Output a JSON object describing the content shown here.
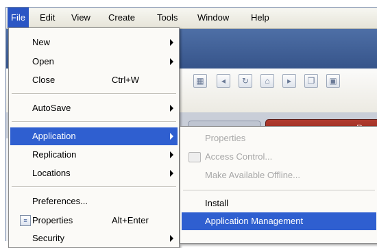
{
  "menubar": {
    "items": [
      "File",
      "Edit",
      "View",
      "Create",
      "Tools",
      "Window",
      "Help"
    ],
    "active_index": 0
  },
  "tab": {
    "partial_label": "Dea"
  },
  "toolbar_icons": [
    "form-icon",
    "back-icon",
    "refresh-icon",
    "home-icon",
    "forward-icon",
    "copy-icon",
    "save-icon"
  ],
  "file_menu": {
    "items": [
      {
        "label": "New",
        "submenu": true
      },
      {
        "label": "Open",
        "submenu": true
      },
      {
        "label": "Close",
        "shortcut": "Ctrl+W"
      },
      {
        "label": "AutoSave",
        "submenu": true
      },
      {
        "label": "Application",
        "submenu": true,
        "selected": true
      },
      {
        "label": "Replication",
        "submenu": true
      },
      {
        "label": "Locations",
        "submenu": true
      },
      {
        "label": "Preferences..."
      },
      {
        "label": "Properties",
        "shortcut": "Alt+Enter",
        "icon": "properties-icon"
      },
      {
        "label": "Security",
        "submenu": true
      }
    ]
  },
  "application_submenu": {
    "items": [
      {
        "label": "Properties",
        "disabled": true
      },
      {
        "label": "Access Control...",
        "disabled": true,
        "icon": "access-control-icon"
      },
      {
        "label": "Make Available Offline...",
        "disabled": true
      },
      {
        "label": "Install"
      },
      {
        "label": "Application Management",
        "selected": true
      }
    ]
  },
  "colors": {
    "selection": "#2f5fd0",
    "menubar_active": "#2b56c4",
    "tab_red": "#a3342a",
    "banner_blue": "#4e6fa6"
  }
}
